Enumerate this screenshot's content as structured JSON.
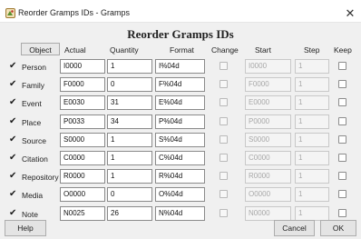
{
  "window": {
    "title": "Reorder Gramps IDs - Gramps",
    "close_glyph": "✕"
  },
  "heading": "Reorder Gramps IDs",
  "headers": {
    "object": "Object",
    "actual": "Actual",
    "quantity": "Quantity",
    "format": "Format",
    "change": "Change",
    "start": "Start",
    "step": "Step",
    "keep": "Keep"
  },
  "rows": [
    {
      "label": "Person",
      "actual": "I0000",
      "quantity": "1",
      "format": "I%04d",
      "start": "I0000",
      "step": "1"
    },
    {
      "label": "Family",
      "actual": "F0000",
      "quantity": "0",
      "format": "F%04d",
      "start": "F0000",
      "step": "1"
    },
    {
      "label": "Event",
      "actual": "E0030",
      "quantity": "31",
      "format": "E%04d",
      "start": "E0000",
      "step": "1"
    },
    {
      "label": "Place",
      "actual": "P0033",
      "quantity": "34",
      "format": "P%04d",
      "start": "P0000",
      "step": "1"
    },
    {
      "label": "Source",
      "actual": "S0000",
      "quantity": "1",
      "format": "S%04d",
      "start": "S0000",
      "step": "1"
    },
    {
      "label": "Citation",
      "actual": "C0000",
      "quantity": "1",
      "format": "C%04d",
      "start": "C0000",
      "step": "1"
    },
    {
      "label": "Repository",
      "actual": "R0000",
      "quantity": "1",
      "format": "R%04d",
      "start": "R0000",
      "step": "1"
    },
    {
      "label": "Media",
      "actual": "O0000",
      "quantity": "0",
      "format": "O%04d",
      "start": "O0000",
      "step": "1"
    },
    {
      "label": "Note",
      "actual": "N0025",
      "quantity": "26",
      "format": "N%04d",
      "start": "N0000",
      "step": "1"
    }
  ],
  "check_glyph": "✔",
  "buttons": {
    "help": "Help",
    "cancel": "Cancel",
    "ok": "OK"
  }
}
